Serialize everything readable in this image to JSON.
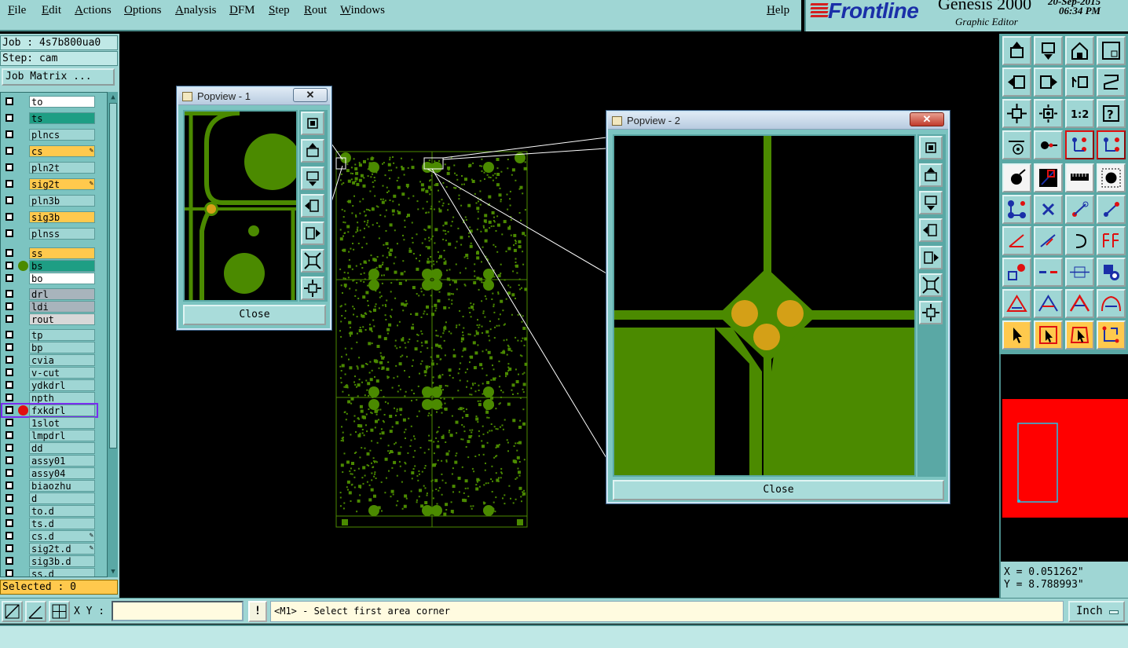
{
  "menu": {
    "file": "File",
    "edit": "Edit",
    "actions": "Actions",
    "options": "Options",
    "analysis": "Analysis",
    "dfm": "DFM",
    "step": "Step",
    "rout": "Rout",
    "windows": "Windows",
    "help": "Help"
  },
  "brand": {
    "logo": "Frontline",
    "product": "Genesis 2000",
    "date": "20-Sep-2015",
    "time": "06:34 PM",
    "subtitle": "Graphic Editor"
  },
  "left": {
    "job": "Job : 4s7b800ua0",
    "step": "Step: cam",
    "job_matrix": "Job Matrix ...",
    "selected": "Selected : 0"
  },
  "layers": [
    {
      "name": "to",
      "color": "#ffffff"
    },
    {
      "name": "ts",
      "color": "#1e9e84"
    },
    {
      "name": "plncs",
      "color": "#9fd6d4"
    },
    {
      "name": "cs",
      "color": "#ffc94d",
      "edit": true
    },
    {
      "name": "pln2t",
      "color": "#9fd6d4"
    },
    {
      "name": "sig2t",
      "color": "#ffc94d",
      "edit": true
    },
    {
      "name": "pln3b",
      "color": "#9fd6d4"
    },
    {
      "name": "sig3b",
      "color": "#ffc94d"
    },
    {
      "name": "plnss",
      "color": "#9fd6d4"
    },
    {
      "name": "ss",
      "color": "#ffc94d"
    },
    {
      "name": "bs",
      "color": "#1e9e84",
      "dot": "#4b8a00"
    },
    {
      "name": "bo",
      "color": "#ffffff"
    },
    {
      "name": "drl",
      "color": "#a8b4bc"
    },
    {
      "name": "ldi",
      "color": "#a8b4bc"
    },
    {
      "name": "rout",
      "color": "#d8d8d8"
    },
    {
      "name": "tp",
      "color": "#9fd6d4"
    },
    {
      "name": "bp",
      "color": "#9fd6d4"
    },
    {
      "name": "cvia",
      "color": "#9fd6d4"
    },
    {
      "name": "v-cut",
      "color": "#9fd6d4"
    },
    {
      "name": "ydkdrl",
      "color": "#9fd6d4"
    },
    {
      "name": "npth",
      "color": "#9fd6d4"
    },
    {
      "name": "fxkdrl",
      "color": "#9fd6d4",
      "dot": "#e01010",
      "highlight": true
    },
    {
      "name": "1slot",
      "color": "#9fd6d4"
    },
    {
      "name": "lmpdrl",
      "color": "#9fd6d4"
    },
    {
      "name": "dd",
      "color": "#9fd6d4"
    },
    {
      "name": "assy01",
      "color": "#9fd6d4"
    },
    {
      "name": "assy04",
      "color": "#9fd6d4"
    },
    {
      "name": "biaozhu",
      "color": "#9fd6d4"
    },
    {
      "name": "d",
      "color": "#9fd6d4"
    },
    {
      "name": "to.d",
      "color": "#9fd6d4"
    },
    {
      "name": "ts.d",
      "color": "#9fd6d4"
    },
    {
      "name": "cs.d",
      "color": "#9fd6d4",
      "edit": true
    },
    {
      "name": "sig2t.d",
      "color": "#9fd6d4",
      "edit": true
    },
    {
      "name": "sig3b.d",
      "color": "#9fd6d4"
    },
    {
      "name": "ss.d",
      "color": "#9fd6d4"
    }
  ],
  "popup1": {
    "title": "Popview - 1",
    "close": "Close"
  },
  "popup2": {
    "title": "Popview - 2",
    "close": "Close"
  },
  "coords": {
    "x": "X = 0.051262\"",
    "y": "Y = 8.788993\""
  },
  "bottom": {
    "xy_label": "X Y :",
    "xy_value": "",
    "bang": "!",
    "prompt": "<M1> - Select first area corner",
    "units": "Inch"
  },
  "colors": {
    "panel": "#9fd6d4",
    "trace": "#4b8a00",
    "pad": "#d4a017",
    "selected": "#ffc94d"
  }
}
